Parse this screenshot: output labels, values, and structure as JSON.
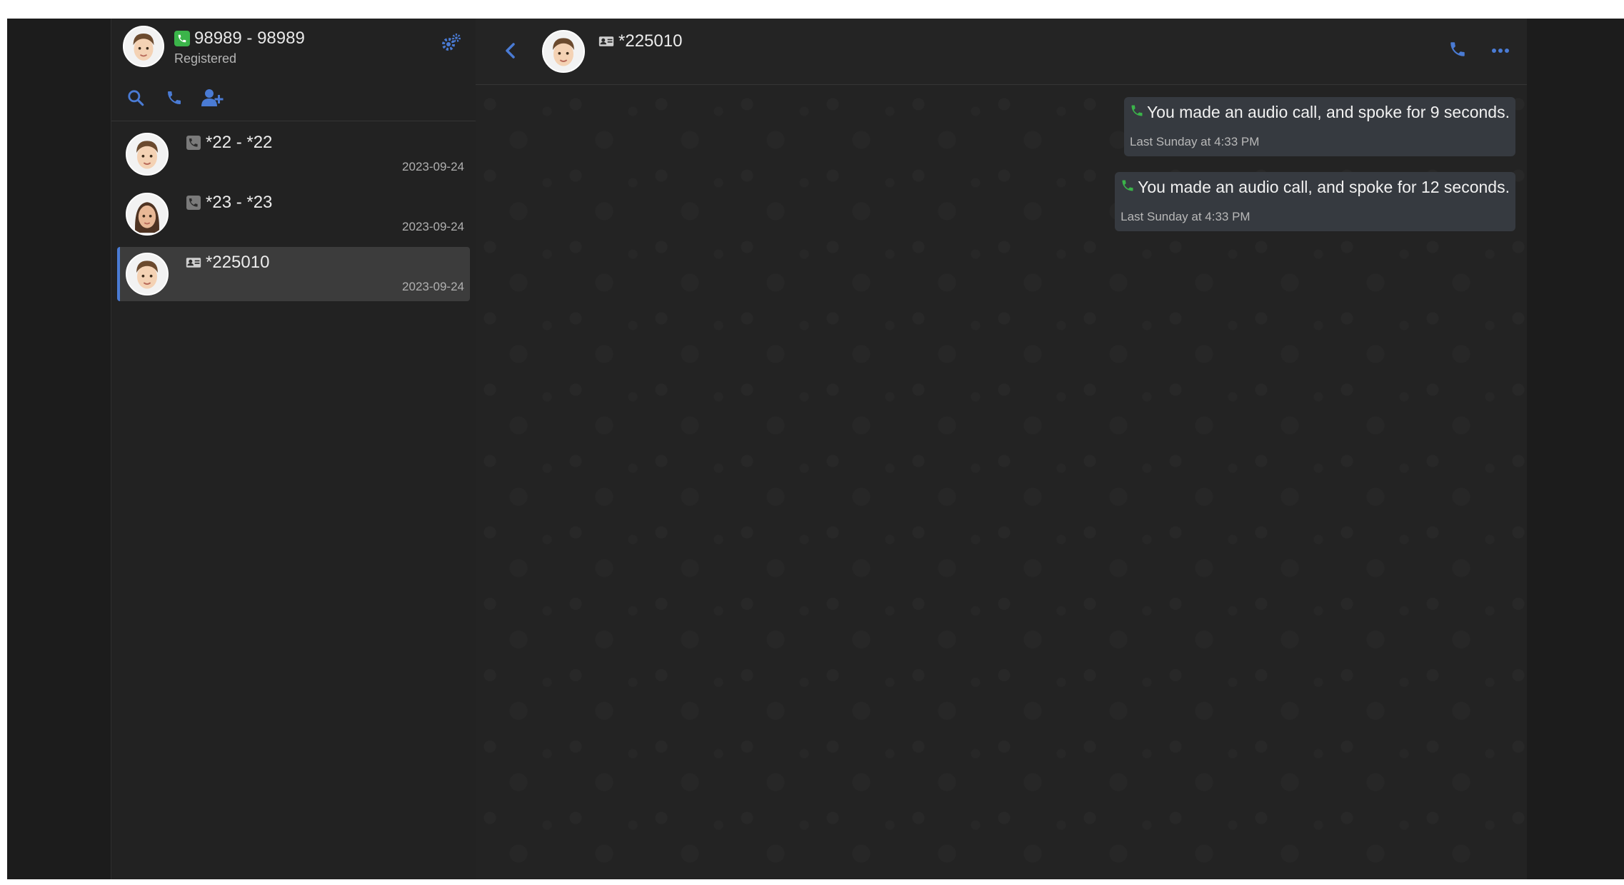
{
  "account": {
    "name": "98989 - 98989",
    "status": "Registered"
  },
  "toolbar": {
    "icons": [
      "search-icon",
      "phone-icon",
      "add-contact-icon"
    ]
  },
  "conversations": [
    {
      "title": "*22 - *22",
      "date": "2023-09-24",
      "type_icon": "phone-icon",
      "active": false
    },
    {
      "title": "*23 - *23",
      "date": "2023-09-24",
      "type_icon": "phone-icon",
      "active": false
    },
    {
      "title": "*225010",
      "date": "2023-09-24",
      "type_icon": "contact-card-icon",
      "active": true
    }
  ],
  "chat": {
    "title": "*225010",
    "messages": [
      {
        "text": "You made an audio call, and spoke for 9 seconds.",
        "time": "Last Sunday at 4:33 PM"
      },
      {
        "text": "You made an audio call, and spoke for 12 seconds.",
        "time": "Last Sunday at 4:33 PM"
      }
    ]
  },
  "colors": {
    "accent": "#4a7bd4",
    "call_green": "#3bb44a",
    "background": "#1d1d1d",
    "bubble": "#363a40"
  }
}
